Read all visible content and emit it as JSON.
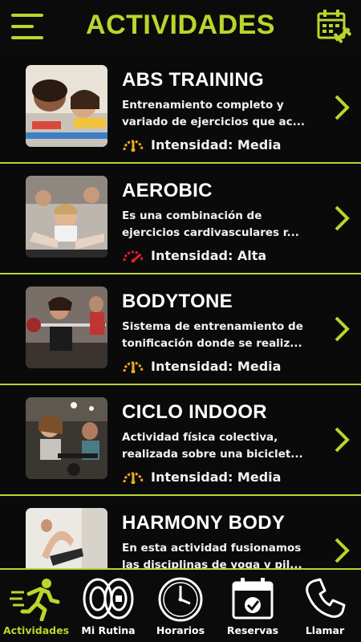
{
  "header": {
    "title": "ACTIVIDADES",
    "menu_icon": "hamburger-menu-icon",
    "calendar_icon": "calendar-dumbbell-icon",
    "accent_color": "#b8d62c"
  },
  "activities": [
    {
      "name": "ABS TRAINING",
      "desc_line1": "Entrenamiento completo y",
      "desc_line2": "variado de ejercicios que ac...",
      "intensity": "Intensidad: Media",
      "level": "media",
      "gauge_color": "#f0a81c"
    },
    {
      "name": "AEROBIC",
      "desc_line1": "Es una combinación de",
      "desc_line2": "ejercicios cardivasculares r...",
      "intensity": "Intensidad: Alta",
      "level": "alta",
      "gauge_color": "#e0202a"
    },
    {
      "name": "BODYTONE",
      "desc_line1": "Sistema de entrenamiento de",
      "desc_line2": "tonificación donde se realiz...",
      "intensity": "Intensidad: Media",
      "level": "media",
      "gauge_color": "#f0a81c"
    },
    {
      "name": "CICLO INDOOR",
      "desc_line1": "Actividad física colectiva,",
      "desc_line2": "realizada sobre una biciclet...",
      "intensity": "Intensidad: Media",
      "level": "media",
      "gauge_color": "#f0a81c"
    },
    {
      "name": "HARMONY BODY",
      "desc_line1": "En esta actividad fusionamos",
      "desc_line2": "las disciplinas de yoga y pil...",
      "intensity": "",
      "level": "",
      "gauge_color": ""
    }
  ],
  "tabs": [
    {
      "label": "Actividades",
      "icon": "running-person-icon",
      "active": true
    },
    {
      "label": "Mi Rutina",
      "icon": "weight-plates-icon",
      "active": false
    },
    {
      "label": "Horarios",
      "icon": "clock-icon",
      "active": false
    },
    {
      "label": "Reservas",
      "icon": "calendar-check-icon",
      "active": false
    },
    {
      "label": "Llamar",
      "icon": "phone-icon",
      "active": false
    }
  ]
}
